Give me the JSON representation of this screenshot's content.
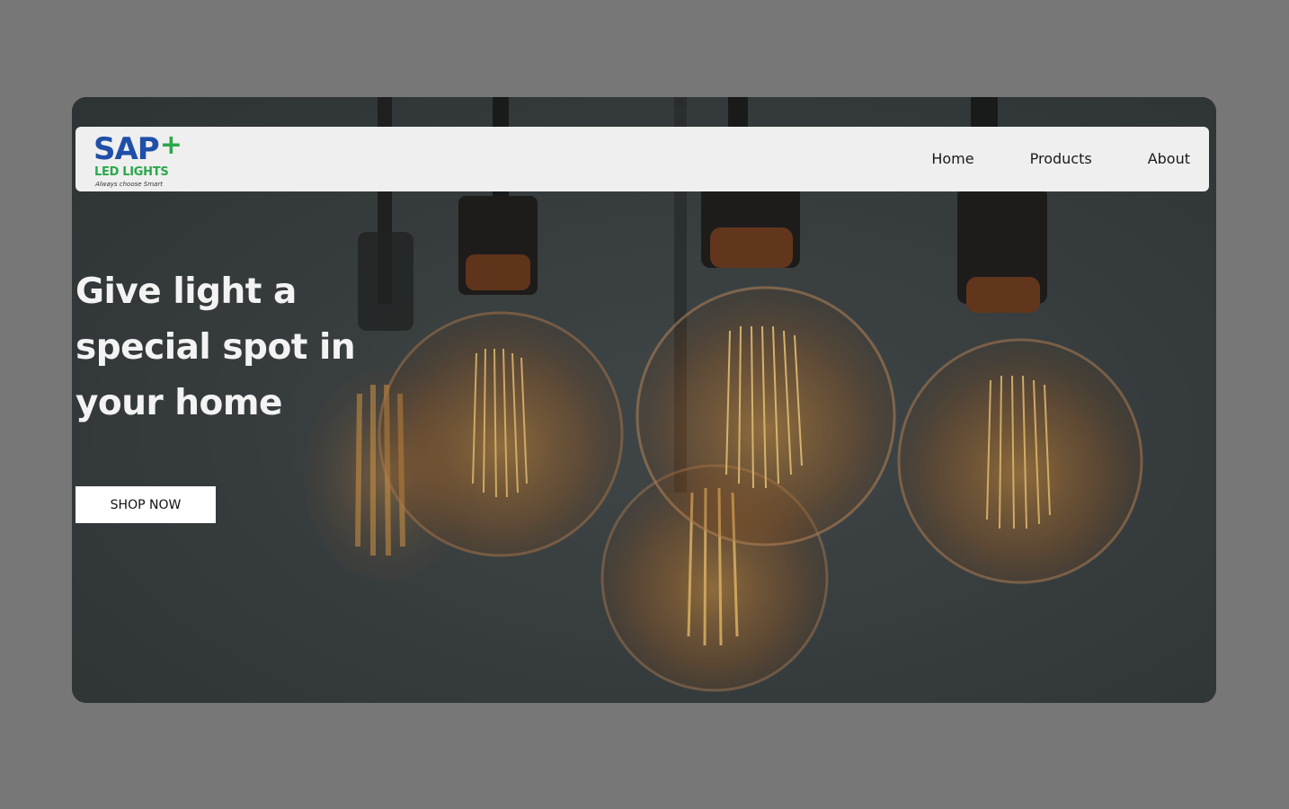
{
  "brand": {
    "name": "SAP",
    "plus": "+",
    "subtitle": "LED LIGHTS",
    "tagline": "Always choose Smart",
    "colors": {
      "primary": "#1f4fa8",
      "accent": "#2aa84a"
    }
  },
  "nav": {
    "items": [
      {
        "label": "Home"
      },
      {
        "label": "Products"
      },
      {
        "label": "About"
      }
    ]
  },
  "hero": {
    "headline": "Give light a special spot in your home",
    "cta_label": "SHOP NOW"
  }
}
